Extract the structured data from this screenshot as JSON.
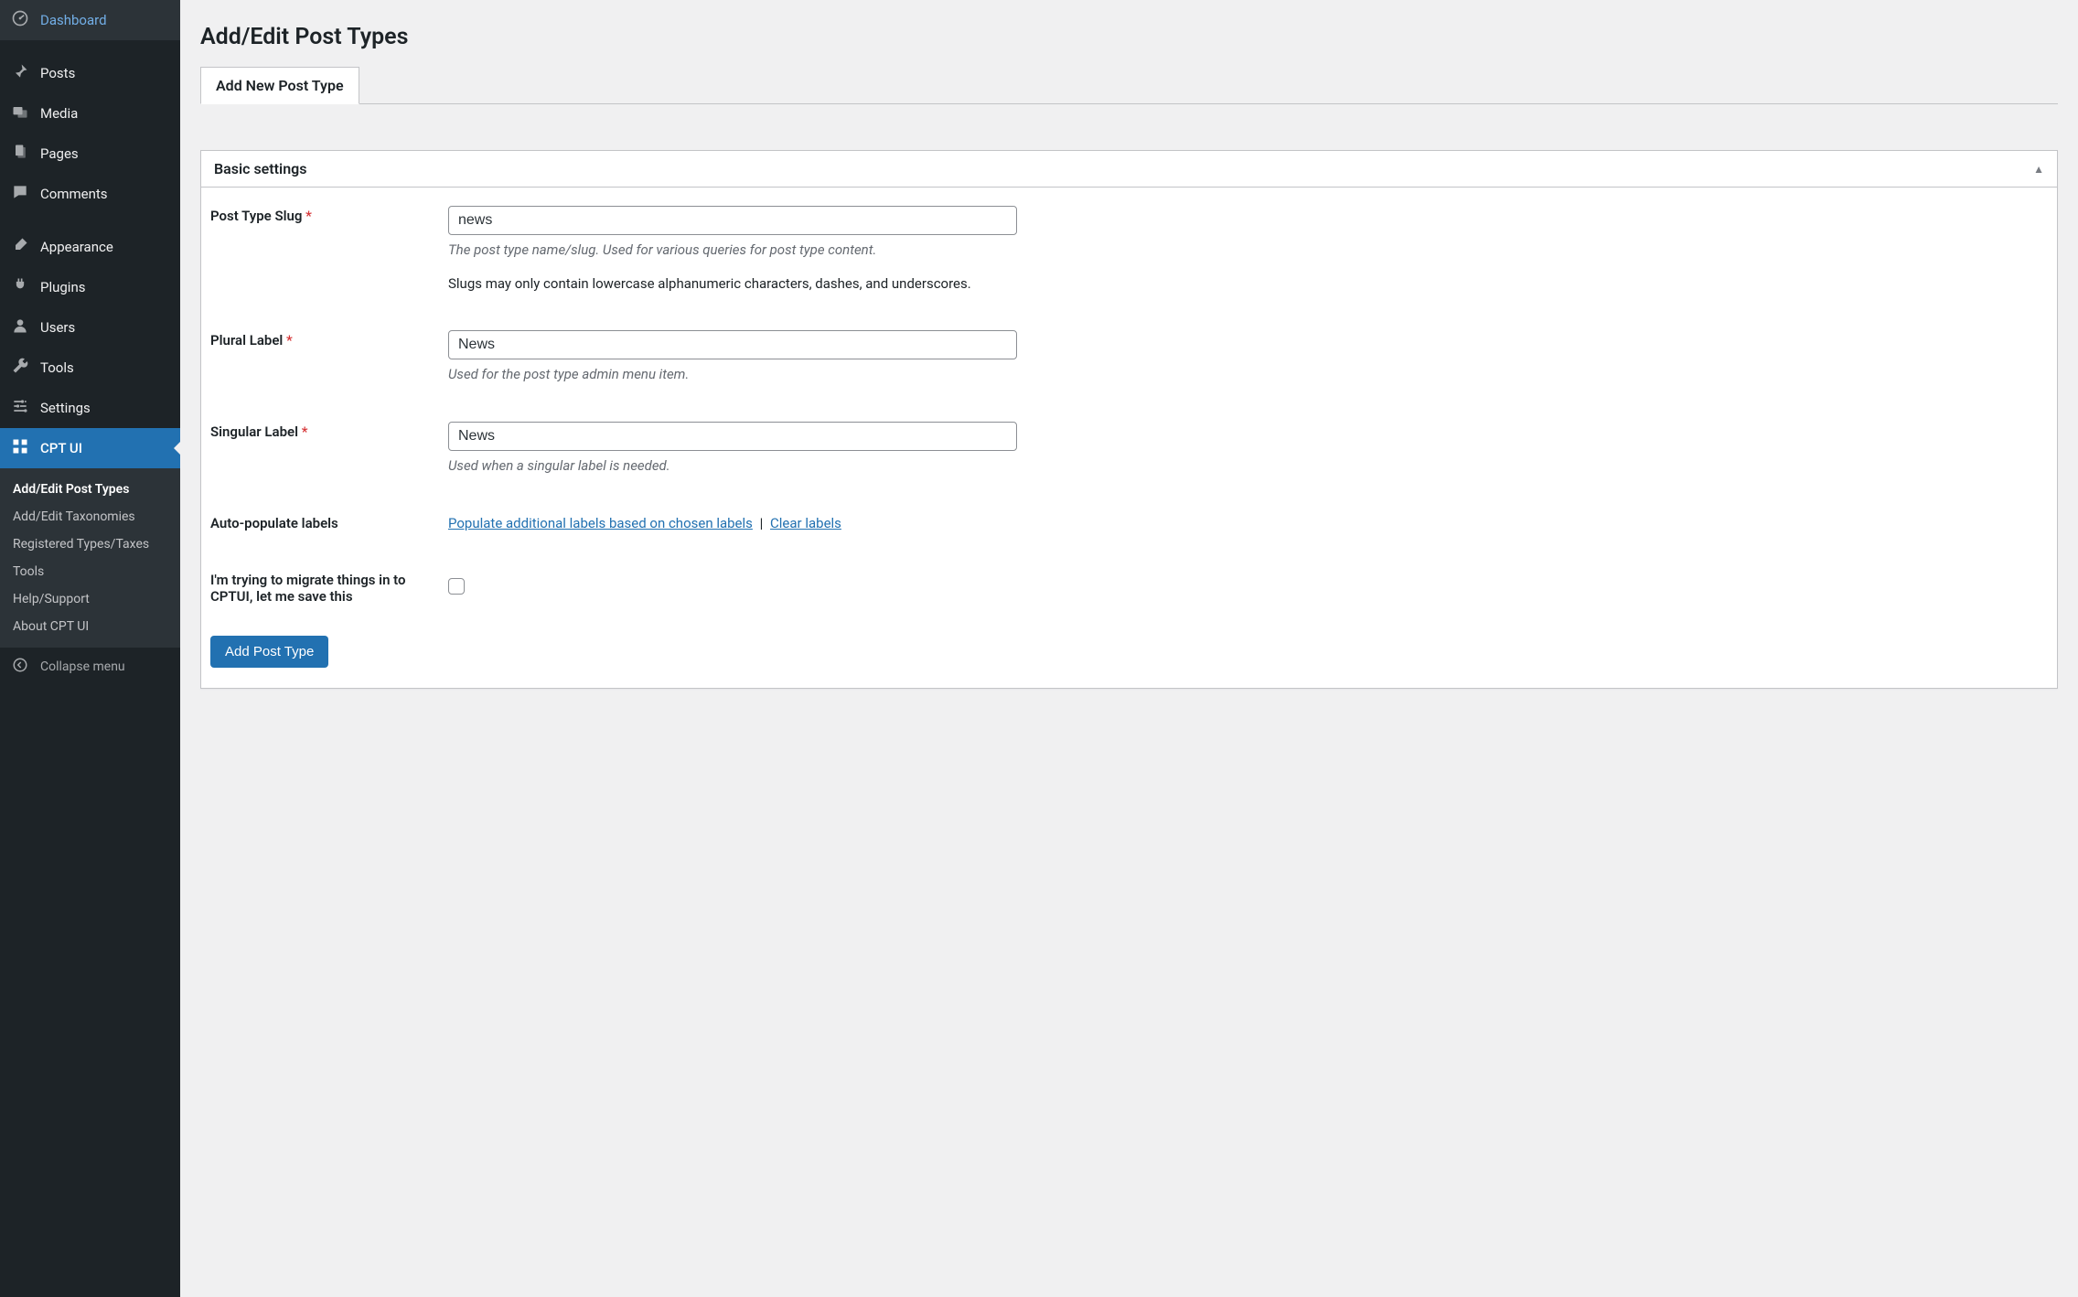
{
  "sidebar": {
    "items": [
      {
        "icon": "gauge",
        "label": "Dashboard"
      },
      {
        "icon": "pin",
        "label": "Posts"
      },
      {
        "icon": "media",
        "label": "Media"
      },
      {
        "icon": "pages",
        "label": "Pages"
      },
      {
        "icon": "comment",
        "label": "Comments"
      },
      {
        "icon": "brush",
        "label": "Appearance"
      },
      {
        "icon": "plug",
        "label": "Plugins"
      },
      {
        "icon": "user",
        "label": "Users"
      },
      {
        "icon": "wrench",
        "label": "Tools"
      },
      {
        "icon": "sliders",
        "label": "Settings"
      },
      {
        "icon": "grid",
        "label": "CPT UI"
      }
    ],
    "submenu": [
      "Add/Edit Post Types",
      "Add/Edit Taxonomies",
      "Registered Types/Taxes",
      "Tools",
      "Help/Support",
      "About CPT UI"
    ],
    "collapse": "Collapse menu"
  },
  "page": {
    "title": "Add/Edit Post Types",
    "tab_label": "Add New Post Type",
    "panel_title": "Basic settings"
  },
  "form": {
    "slug": {
      "label": "Post Type Slug",
      "value": "news",
      "desc": "The post type name/slug. Used for various queries for post type content.",
      "note": "Slugs may only contain lowercase alphanumeric characters, dashes, and underscores."
    },
    "plural": {
      "label": "Plural Label",
      "value": "News",
      "desc": "Used for the post type admin menu item."
    },
    "singular": {
      "label": "Singular Label",
      "value": "News",
      "desc": "Used when a singular label is needed."
    },
    "autopop": {
      "label": "Auto-populate labels",
      "link1": "Populate additional labels based on chosen labels",
      "sep": " | ",
      "link2": "Clear labels"
    },
    "migrate": {
      "label": "I'm trying to migrate things in to CPTUI, let me save this"
    },
    "submit": "Add Post Type"
  }
}
